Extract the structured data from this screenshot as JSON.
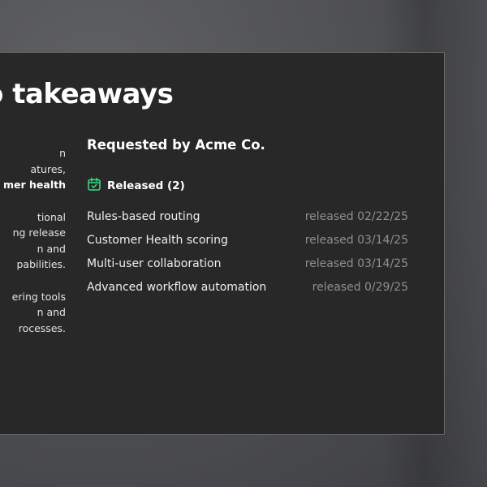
{
  "colors": {
    "accent_green": "#3ddc84",
    "card_bg": "#282829",
    "muted_text": "#8f8f92"
  },
  "heading": "o takeaways",
  "left_column": {
    "lines": [
      "n",
      "atures,",
      "mer health",
      "",
      "tional",
      "ng release",
      "n and",
      "pabilities.",
      "",
      "ering tools",
      "n and",
      "rocesses."
    ]
  },
  "requested_by": "Requested by Acme Co.",
  "released_section": {
    "icon": "calendar-check-icon",
    "label": "Released (2)",
    "items": [
      {
        "name": "Rules-based routing",
        "date": "released 02/22/25"
      },
      {
        "name": "Customer Health scoring",
        "date": "released 03/14/25"
      },
      {
        "name": "Multi-user collaboration",
        "date": "released 03/14/25"
      },
      {
        "name": "Advanced workflow automation",
        "date": "released 0/29/25"
      }
    ]
  }
}
